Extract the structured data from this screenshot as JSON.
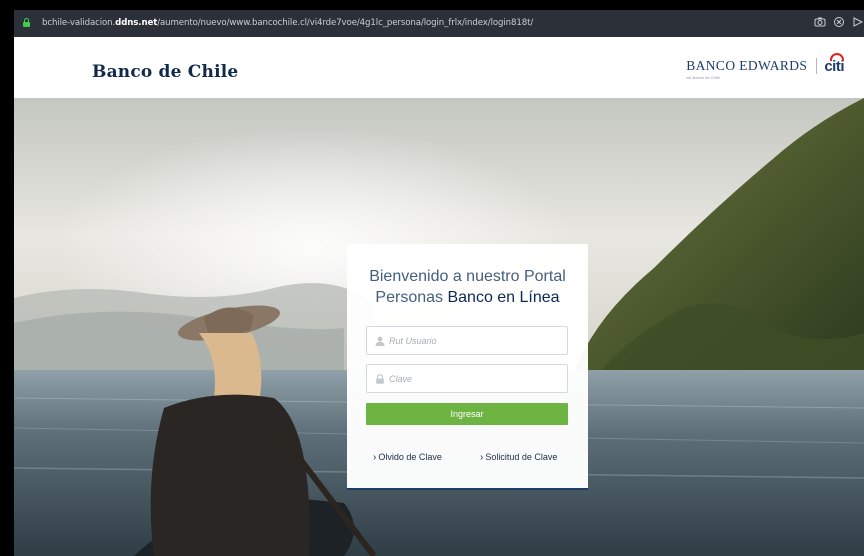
{
  "browser": {
    "url_prefix": "bchile-validacion.",
    "url_host_bold": "ddns.net",
    "url_path": "/aumento/nuevo/www.bancochile.cl/vi4rde7voe/4g1lc_persona/login_frlx/index/login818t/"
  },
  "header": {
    "brand_left": "Banco de Chile",
    "brand_right": "BANCO EDWARDS",
    "brand_right_sub": "del Banco de Chile",
    "brand_citi": "citi"
  },
  "login": {
    "title_line1": "Bienvenido a nuestro Portal",
    "title_line2_prefix": "Personas",
    "title_line2_strong": "Banco en Línea",
    "user_placeholder": "Rut Usuario",
    "password_placeholder": "Clave",
    "submit_label": "Ingresar",
    "link_forgot": "Olvido de Clave",
    "link_request": "Solicitud de Clave"
  },
  "icons": {
    "lock": "lock-icon",
    "user": "user-icon",
    "password": "padlock-icon",
    "camera": "camera-icon",
    "shield": "shield-icon",
    "send": "send-icon"
  },
  "colors": {
    "header_bg": "#2c3139",
    "brand_navy": "#102a4c",
    "button_green": "#6eb443",
    "lock_green": "#3ccf4e",
    "citi_red": "#e1251b"
  }
}
